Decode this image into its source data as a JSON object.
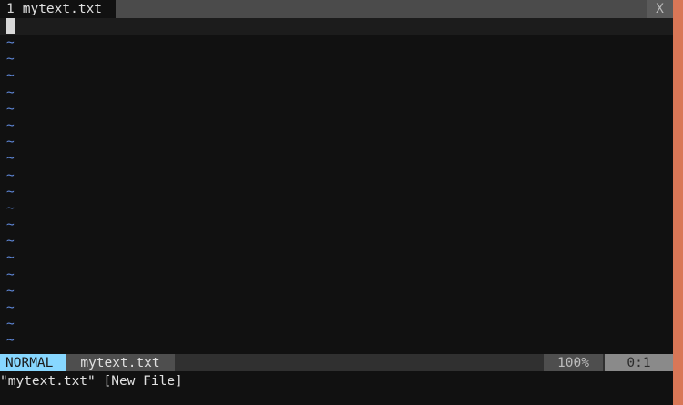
{
  "tabline": {
    "tab_number": "1",
    "tab_label": "mytext.txt",
    "close_label": "X"
  },
  "editor": {
    "tilde_char": "~",
    "empty_line_count": 19,
    "colors": {
      "tilde": "#5f87d7",
      "background": "#111111"
    }
  },
  "statusline": {
    "mode": "NORMAL",
    "filename": "mytext.txt",
    "percent": "100%",
    "position": "0:1",
    "colors": {
      "mode_bg": "#87d7ff"
    }
  },
  "cmdline": {
    "message": "\"mytext.txt\" [New File]"
  },
  "accent": {
    "edge_color": "#d97757"
  }
}
